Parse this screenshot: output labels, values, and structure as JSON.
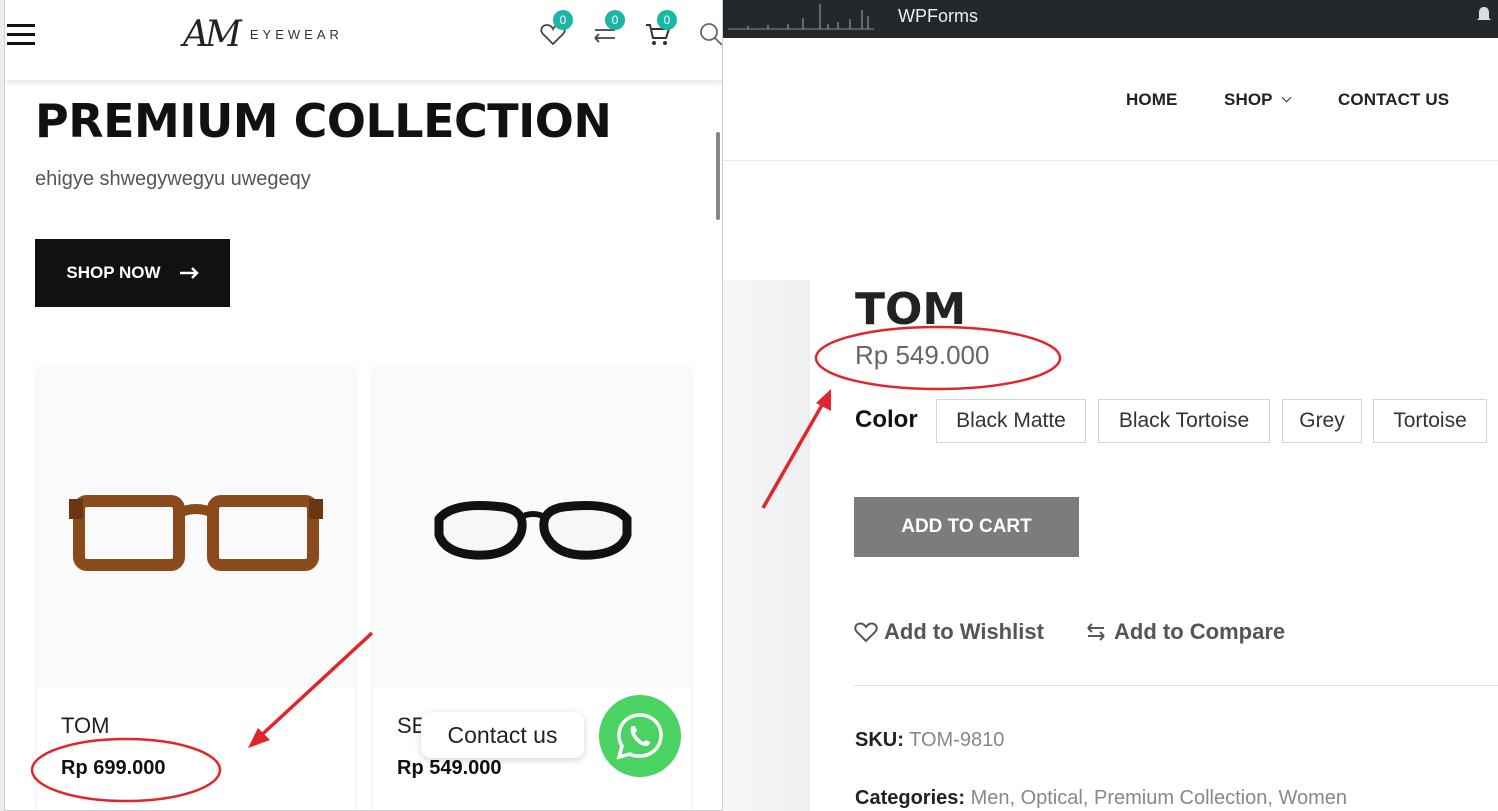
{
  "admin_bar": {
    "plugin_label": "WPForms"
  },
  "site_nav": {
    "items": [
      "HOME",
      "SHOP",
      "CONTACT US"
    ]
  },
  "product": {
    "title": "TOM",
    "price": "Rp 549.000",
    "color_label": "Color",
    "colors": [
      "Black Matte",
      "Black Tortoise",
      "Grey",
      "Tortoise"
    ],
    "add_to_cart": "ADD TO CART",
    "wishlist": "Add to Wishlist",
    "compare": "Add to Compare",
    "sku_label": "SKU:",
    "sku_value": "TOM-9810",
    "categories_label": "Categories:",
    "categories_value": "Men, Optical, Premium Collection, Women"
  },
  "mobile": {
    "logo_mark": "AM",
    "logo_word": "EYEWEAR",
    "counts": {
      "wishlist": "0",
      "compare": "0",
      "cart": "0"
    },
    "hero_title": "PREMIUM COLLECTION",
    "hero_subtitle": "ehigye shwegywegyu uwegeqy",
    "shop_now": "SHOP NOW",
    "products": [
      {
        "name": "TOM",
        "price": "Rp 699.000",
        "frame_color": "#8a4a1c"
      },
      {
        "name": "SE",
        "price": "Rp 549.000",
        "frame_color": "#111111"
      }
    ],
    "contact_label": "Contact us"
  },
  "colors": {
    "accent_badge": "#1ab7a3",
    "whatsapp": "#4ad363",
    "annotation": "#e0262b"
  }
}
